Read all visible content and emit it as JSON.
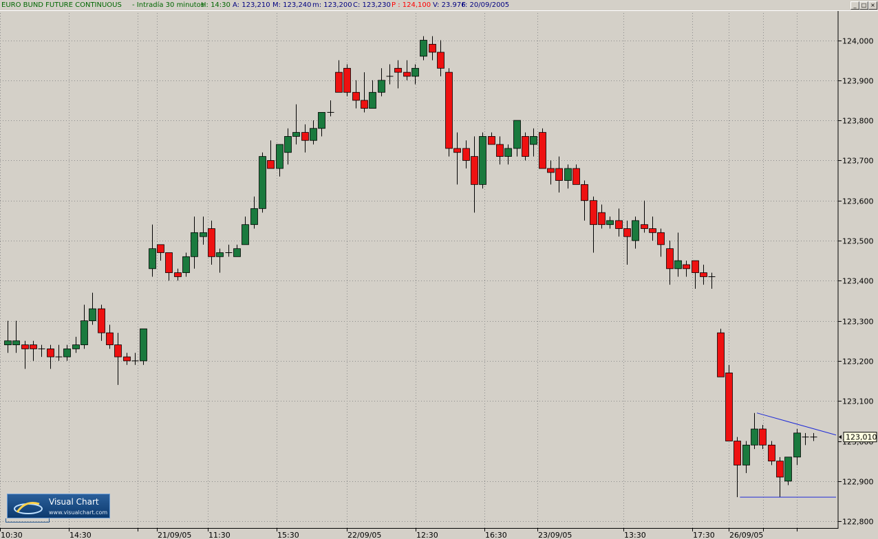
{
  "window": {
    "title": "EURO BUND FUTURE CONTINUOUS",
    "timeframe": "- Intradía 30 minutos",
    "stats": [
      {
        "label": "H: 14:30",
        "color": "#006600"
      },
      {
        "label": "A: 123,210",
        "color": "#000080"
      },
      {
        "label": "M: 123,240",
        "color": "#000080"
      },
      {
        "label": "m: 123,200",
        "color": "#000080"
      },
      {
        "label": "C: 123,230",
        "color": "#000080"
      },
      {
        "label": "P : 124,100",
        "color": "#ff0000"
      },
      {
        "label": "V: 23.976",
        "color": "#000080"
      },
      {
        "label": "F: 20/09/2005",
        "color": "#000080"
      }
    ],
    "buttons": [
      "_",
      "□",
      "×"
    ]
  },
  "logo": {
    "name": "Visual Chart",
    "url": "www.visualchart.com"
  },
  "chart_data": {
    "type": "candlestick",
    "y_ticks": [
      "124,000",
      "123,900",
      "123,800",
      "123,700",
      "123,600",
      "123,500",
      "123,400",
      "123,300",
      "123,200",
      "123,100",
      "123,000",
      "122,900",
      "122,800"
    ],
    "ylim": [
      122.78,
      124.095
    ],
    "last_price_label": "123,010",
    "x_labels": [
      "10:30",
      "14:30",
      "21/09/05",
      "11:30",
      "15:30",
      "22/09/05",
      "12:30",
      "16:30",
      "23/09/05",
      "13:30",
      "17:30",
      "26/09/05"
    ],
    "grid": true,
    "colors": {
      "up": "#1a7a3e",
      "down": "#ee1111",
      "background": "#d4d0c8",
      "wick": "#000000",
      "trendline": "#1e2ad8"
    },
    "candles": [
      [
        123.24,
        123.3,
        123.22,
        123.25
      ],
      [
        123.24,
        123.3,
        123.22,
        123.25
      ],
      [
        123.24,
        123.25,
        123.18,
        123.23
      ],
      [
        123.24,
        123.25,
        123.2,
        123.23
      ],
      [
        123.23,
        123.24,
        123.21,
        123.23
      ],
      [
        123.23,
        123.24,
        123.18,
        123.21
      ],
      [
        123.21,
        123.24,
        123.2,
        123.21
      ],
      [
        123.21,
        123.24,
        123.2,
        123.23
      ],
      [
        123.23,
        123.26,
        123.22,
        123.24
      ],
      [
        123.24,
        123.34,
        123.23,
        123.3
      ],
      [
        123.3,
        123.37,
        123.29,
        123.33
      ],
      [
        123.33,
        123.34,
        123.25,
        123.27
      ],
      [
        123.27,
        123.29,
        123.23,
        123.24
      ],
      [
        123.24,
        123.27,
        123.14,
        123.21
      ],
      [
        123.21,
        123.22,
        123.19,
        123.2
      ],
      [
        123.2,
        123.22,
        123.19,
        123.2
      ],
      [
        123.2,
        123.28,
        123.19,
        123.28
      ],
      [
        123.43,
        123.54,
        123.41,
        123.48
      ],
      [
        123.49,
        123.49,
        123.45,
        123.47
      ],
      [
        123.47,
        123.47,
        123.4,
        123.42
      ],
      [
        123.42,
        123.43,
        123.4,
        123.41
      ],
      [
        123.42,
        123.47,
        123.41,
        123.46
      ],
      [
        123.46,
        123.56,
        123.43,
        123.52
      ],
      [
        123.51,
        123.56,
        123.49,
        123.52
      ],
      [
        123.53,
        123.55,
        123.44,
        123.46
      ],
      [
        123.46,
        123.48,
        123.42,
        123.47
      ],
      [
        123.47,
        123.49,
        123.46,
        123.47
      ],
      [
        123.46,
        123.49,
        123.46,
        123.48
      ],
      [
        123.49,
        123.56,
        123.49,
        123.54
      ],
      [
        123.54,
        123.61,
        123.53,
        123.58
      ],
      [
        123.58,
        123.72,
        123.57,
        123.71
      ],
      [
        123.7,
        123.75,
        123.68,
        123.68
      ],
      [
        123.68,
        123.74,
        123.66,
        123.74
      ],
      [
        123.72,
        123.78,
        123.69,
        123.76
      ],
      [
        123.76,
        123.84,
        123.74,
        123.77
      ],
      [
        123.77,
        123.79,
        123.72,
        123.75
      ],
      [
        123.75,
        123.8,
        123.74,
        123.78
      ],
      [
        123.78,
        123.82,
        123.76,
        123.82
      ],
      [
        123.82,
        123.85,
        123.81,
        123.82
      ],
      [
        123.92,
        123.95,
        123.87,
        123.87
      ],
      [
        123.93,
        123.94,
        123.86,
        123.87
      ],
      [
        123.87,
        123.9,
        123.83,
        123.85
      ],
      [
        123.85,
        123.92,
        123.82,
        123.83
      ],
      [
        123.83,
        123.9,
        123.83,
        123.87
      ],
      [
        123.87,
        123.93,
        123.86,
        123.9
      ],
      [
        123.91,
        123.94,
        123.89,
        123.91
      ],
      [
        123.93,
        123.95,
        123.88,
        123.92
      ],
      [
        123.92,
        123.95,
        123.9,
        123.91
      ],
      [
        123.91,
        123.94,
        123.89,
        123.93
      ],
      [
        123.96,
        124.01,
        123.95,
        124.0
      ],
      [
        123.99,
        124.01,
        123.95,
        123.97
      ],
      [
        123.97,
        124.0,
        123.91,
        123.93
      ],
      [
        123.92,
        123.93,
        123.71,
        123.73
      ],
      [
        123.73,
        123.77,
        123.64,
        123.72
      ],
      [
        123.73,
        123.75,
        123.68,
        123.7
      ],
      [
        123.71,
        123.76,
        123.57,
        123.64
      ],
      [
        123.64,
        123.77,
        123.63,
        123.76
      ],
      [
        123.76,
        123.77,
        123.74,
        123.74
      ],
      [
        123.74,
        123.76,
        123.69,
        123.71
      ],
      [
        123.71,
        123.74,
        123.69,
        123.73
      ],
      [
        123.73,
        123.8,
        123.71,
        123.8
      ],
      [
        123.76,
        123.77,
        123.7,
        123.71
      ],
      [
        123.74,
        123.78,
        123.71,
        123.76
      ],
      [
        123.77,
        123.78,
        123.68,
        123.68
      ],
      [
        123.68,
        123.7,
        123.64,
        123.67
      ],
      [
        123.68,
        123.71,
        123.62,
        123.65
      ],
      [
        123.65,
        123.69,
        123.63,
        123.68
      ],
      [
        123.68,
        123.69,
        123.64,
        123.64
      ],
      [
        123.64,
        123.65,
        123.55,
        123.6
      ],
      [
        123.6,
        123.61,
        123.47,
        123.54
      ],
      [
        123.57,
        123.59,
        123.53,
        123.54
      ],
      [
        123.54,
        123.56,
        123.53,
        123.55
      ],
      [
        123.55,
        123.58,
        123.51,
        123.53
      ],
      [
        123.53,
        123.55,
        123.44,
        123.51
      ],
      [
        123.5,
        123.56,
        123.48,
        123.55
      ],
      [
        123.54,
        123.6,
        123.52,
        123.53
      ],
      [
        123.53,
        123.56,
        123.5,
        123.52
      ],
      [
        123.52,
        123.53,
        123.46,
        123.49
      ],
      [
        123.48,
        123.5,
        123.39,
        123.43
      ],
      [
        123.43,
        123.52,
        123.41,
        123.45
      ],
      [
        123.44,
        123.45,
        123.41,
        123.43
      ],
      [
        123.45,
        123.45,
        123.38,
        123.42
      ],
      [
        123.42,
        123.44,
        123.39,
        123.41
      ],
      [
        123.41,
        123.42,
        123.38,
        123.41
      ],
      [
        123.27,
        123.28,
        123.16,
        123.16
      ],
      [
        123.17,
        123.19,
        123.0,
        123.0
      ],
      [
        123.0,
        123.01,
        122.86,
        122.94
      ],
      [
        122.94,
        123.0,
        122.92,
        122.99
      ],
      [
        122.99,
        123.07,
        122.98,
        123.03
      ],
      [
        123.03,
        123.04,
        122.98,
        122.99
      ],
      [
        122.99,
        123.0,
        122.94,
        122.95
      ],
      [
        122.95,
        122.96,
        122.86,
        122.91
      ],
      [
        122.9,
        122.96,
        122.89,
        122.96
      ],
      [
        122.96,
        123.03,
        122.94,
        123.02
      ],
      [
        123.01,
        123.02,
        122.99,
        123.01
      ],
      [
        123.01,
        123.02,
        123.0,
        123.01
      ]
    ],
    "trendlines": [
      {
        "from": [
          88,
          123.07
        ],
        "to": [
          98,
          123.015
        ]
      },
      {
        "from": [
          86,
          122.86
        ],
        "to": [
          98,
          122.86
        ]
      }
    ]
  }
}
